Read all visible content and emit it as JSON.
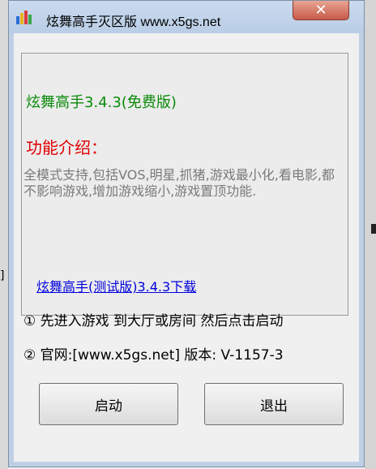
{
  "window": {
    "title": "炫舞高手灭区版 www.x5gs.net",
    "close_glyph": "✕",
    "icon": "app-logo-icon"
  },
  "group": {
    "version_title": "炫舞高手3.4.3(免费版)",
    "intro_heading": "功能介绍：",
    "intro_text": "全模式支持,包括VOS,明星,抓猪,游戏最小化,看电影,都不影响游戏,增加游戏缩小,游戏置顶功能.",
    "download_link": "炫舞高手(测试版)3.4.3下载"
  },
  "info": {
    "line1": "① 先进入游戏 到大厅或房间 然后点击启动",
    "line2": "② 官网:[www.x5gs.net] 版本: V-1157-3"
  },
  "buttons": {
    "start": "启动",
    "exit": "退出"
  },
  "colors": {
    "version_title": "#0a8a0a",
    "intro_heading": "#e00000",
    "intro_text": "#7a7a7a",
    "link": "#0000dd",
    "close_button": "#c75a48"
  }
}
